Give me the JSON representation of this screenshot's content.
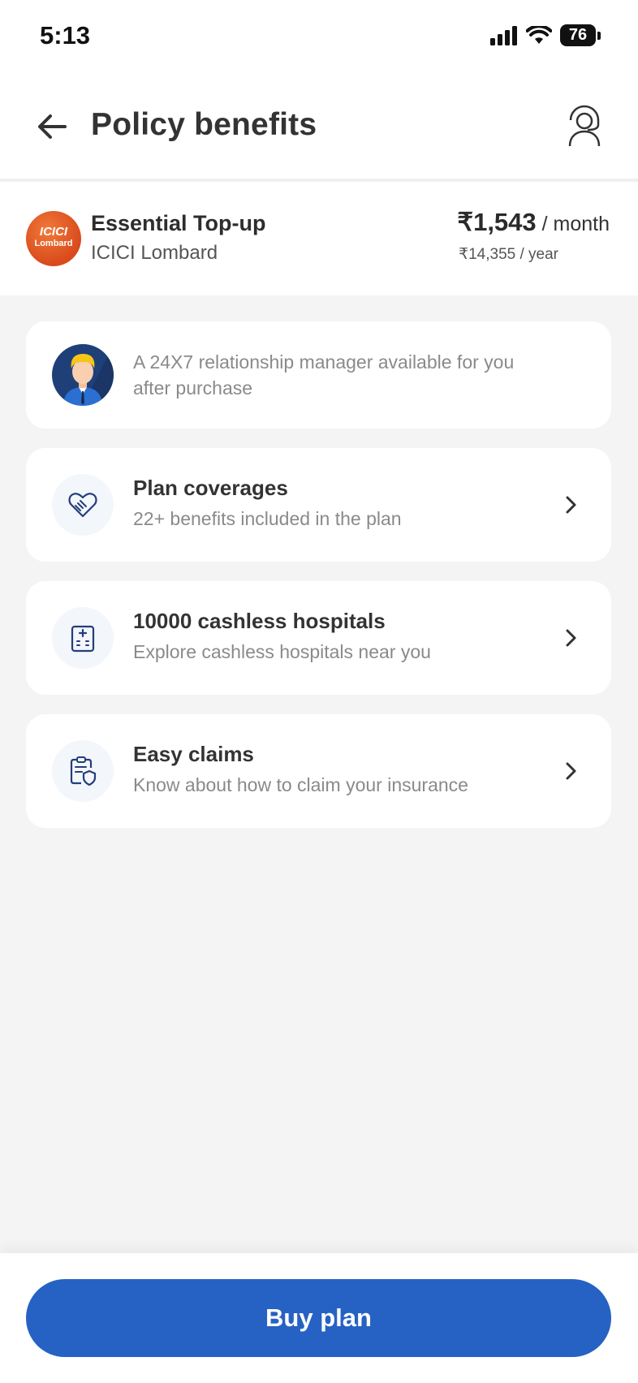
{
  "status_bar": {
    "time": "5:13",
    "battery": "76"
  },
  "header": {
    "title": "Policy benefits"
  },
  "plan": {
    "name": "Essential Top-up",
    "insurer": "ICICI Lombard",
    "logo_top": "ICICI",
    "logo_bottom": "Lombard",
    "price_monthly": "₹1,543",
    "price_monthly_unit": "/ month",
    "price_yearly": "₹14,355 / year"
  },
  "rm_card": {
    "text": "A 24X7 relationship manager available for you after purchase"
  },
  "benefits": [
    {
      "title": "Plan coverages",
      "subtitle": "22+ benefits included in the plan",
      "icon": "handshake-heart-icon"
    },
    {
      "title": "10000 cashless hospitals",
      "subtitle": "Explore cashless hospitals near you",
      "icon": "hospital-icon"
    },
    {
      "title": "Easy claims",
      "subtitle": "Know about how to claim your insurance",
      "icon": "clipboard-shield-icon"
    }
  ],
  "footer": {
    "buy_label": "Buy plan"
  },
  "colors": {
    "primary": "#2662c3",
    "background": "#f4f4f5",
    "logo": "#e05a24",
    "icon_stroke": "#233e7a"
  }
}
